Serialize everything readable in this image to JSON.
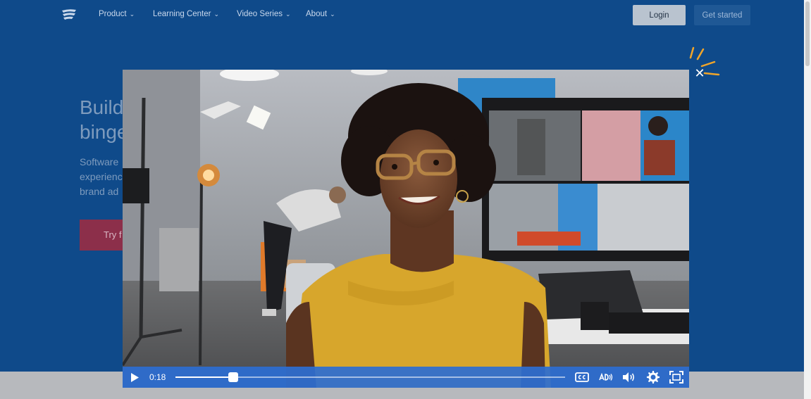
{
  "nav": {
    "items": [
      {
        "label": "Product"
      },
      {
        "label": "Learning Center"
      },
      {
        "label": "Video Series"
      },
      {
        "label": "About"
      }
    ],
    "login_label": "Login",
    "get_started_label": "Get started"
  },
  "hero": {
    "title_line1": "Build",
    "title_line2": "binge",
    "subtitle_line1": "Software",
    "subtitle_line2": "experience",
    "subtitle_line3": "brand ad",
    "cta_label": "Try f"
  },
  "player": {
    "current_time": "0:18",
    "progress_fraction": 0.149,
    "close_icon": "close-icon",
    "icons": [
      "play-icon",
      "cc-icon",
      "audio-description-icon",
      "volume-icon",
      "settings-gear-icon",
      "fullscreen-icon"
    ]
  },
  "colors": {
    "page_bg": "#0f4a8a",
    "control_bar": "#2d6ed2",
    "accent_spark": "#f0a52a",
    "cta": "#8c2f4a"
  }
}
